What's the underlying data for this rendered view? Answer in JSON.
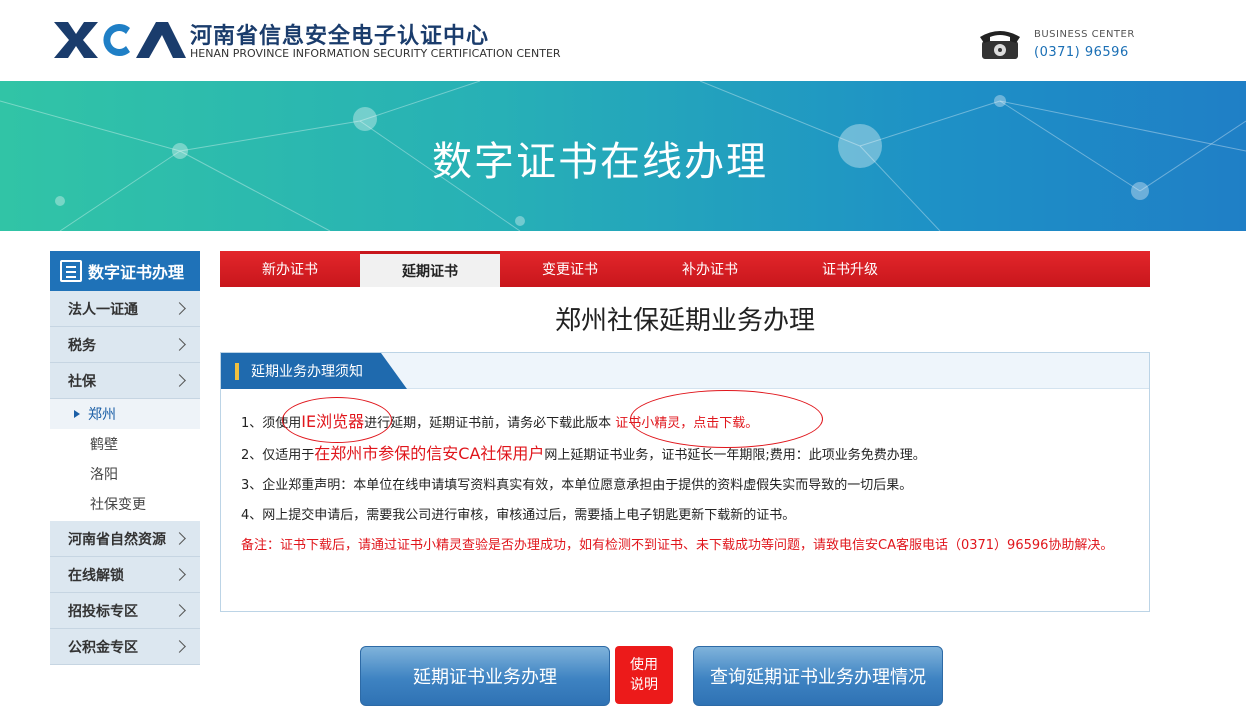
{
  "header": {
    "logo_text": "XACA",
    "org_name_cn": "河南省信息安全电子认证中心",
    "org_name_en": "HENAN PROVINCE INFORMATION SECURITY CERTIFICATION CENTER",
    "business_label": "BUSINESS CENTER",
    "business_phone": "(0371) 96596",
    "phone_icon": "telephone-icon"
  },
  "banner": {
    "title": "数字证书在线办理"
  },
  "sidebar": {
    "heading": "数字证书办理",
    "items": [
      {
        "label": "法人一证通"
      },
      {
        "label": "税务"
      },
      {
        "label": "社保"
      }
    ],
    "sub_items": [
      {
        "label": "郑州",
        "active": true
      },
      {
        "label": "鹤壁"
      },
      {
        "label": "洛阳"
      },
      {
        "label": "社保变更"
      }
    ],
    "items_after": [
      {
        "label": "河南省自然资源"
      },
      {
        "label": "在线解锁"
      },
      {
        "label": "招投标专区"
      },
      {
        "label": "公积金专区"
      }
    ]
  },
  "tabs": [
    {
      "label": "新办证书"
    },
    {
      "label": "延期证书",
      "active": true
    },
    {
      "label": "变更证书"
    },
    {
      "label": "补办证书"
    },
    {
      "label": "证书升级"
    }
  ],
  "page_title": "郑州社保延期业务办理",
  "notice": {
    "heading": "延期业务办理须知",
    "line1_a": "1、须使用",
    "line1_b": "IE浏览器",
    "line1_c": "进行延期，延期证书前，请务必下载此版本 ",
    "line1_link": "证书小精灵，点击下载。",
    "line2_a": "2、仅适用于",
    "line2_b": "在郑州市参保的信安CA社保用户",
    "line2_c": "网上延期证书业务，证书延长一年期限;费用：此项业务免费办理。",
    "line3": "3、企业郑重声明：本单位在线申请填写资料真实有效，本单位愿意承担由于提供的资料虚假失实而导致的一切后果。",
    "line4": "4、网上提交申请后，需要我公司进行审核，审核通过后，需要插上电子钥匙更新下载新的证书。",
    "remark": "备注：证书下载后，请通过证书小精灵查验是否办理成功，如有检测不到证书、未下载成功等问题，请致电信安CA客服电话（0371）96596协助解决。"
  },
  "buttons": {
    "extend": "延期证书业务办理",
    "help_line1": "使用",
    "help_line2": "说明",
    "query": "查询延期证书业务办理情况"
  },
  "colors": {
    "brand_blue": "#1f72b8",
    "tab_red": "#d81e24",
    "accent_red": "#e0161c"
  }
}
